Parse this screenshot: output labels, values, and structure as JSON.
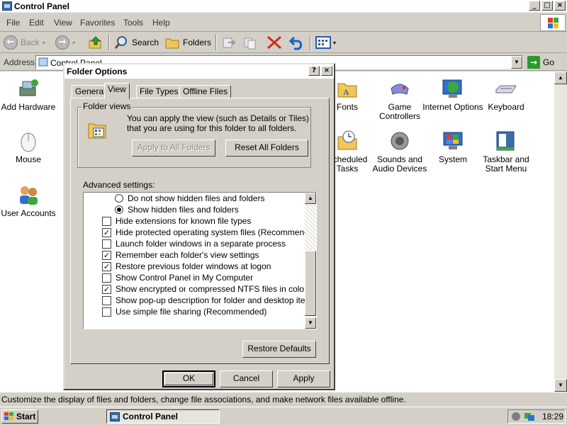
{
  "window": {
    "title": "Control Panel",
    "controls": [
      "_",
      "□",
      "×"
    ]
  },
  "menu": [
    "File",
    "Edit",
    "View",
    "Favorites",
    "Tools",
    "Help"
  ],
  "toolbar": {
    "back": "Back",
    "search": "Search",
    "folders": "Folders"
  },
  "address": {
    "label": "Address",
    "value": "Control Panel",
    "go": "Go"
  },
  "control_panel_items": [
    "Add Hardware",
    "Mouse",
    "User Accounts",
    "Fonts",
    "Game Controllers",
    "Internet Options",
    "Keyboard",
    "Scheduled Tasks",
    "Sounds and Audio Devices",
    "System",
    "Taskbar and Start Menu"
  ],
  "dialog": {
    "title": "Folder Options",
    "title_buttons": [
      "?",
      "×"
    ],
    "tabs": [
      "General",
      "View",
      "File Types",
      "Offline Files"
    ],
    "active_tab": "View",
    "folder_views": {
      "group_title": "Folder views",
      "description": "You can apply the view (such as Details or Tiles) that you are using for this folder to all folders.",
      "apply_all": "Apply to All Folders",
      "reset_all": "Reset All Folders"
    },
    "advanced_label": "Advanced settings:",
    "settings": [
      {
        "type": "radio",
        "label": "Do not show hidden files and folders",
        "checked": false
      },
      {
        "type": "radio",
        "label": "Show hidden files and folders",
        "checked": true
      },
      {
        "type": "checkbox",
        "label": "Hide extensions for known file types",
        "checked": false
      },
      {
        "type": "checkbox",
        "label": "Hide protected operating system files (Recommended)",
        "checked": true
      },
      {
        "type": "checkbox",
        "label": "Launch folder windows in a separate process",
        "checked": false
      },
      {
        "type": "checkbox",
        "label": "Remember each folder's view settings",
        "checked": true
      },
      {
        "type": "checkbox",
        "label": "Restore previous folder windows at logon",
        "checked": true
      },
      {
        "type": "checkbox",
        "label": "Show Control Panel in My Computer",
        "checked": false
      },
      {
        "type": "checkbox",
        "label": "Show encrypted or compressed NTFS files in color",
        "checked": true
      },
      {
        "type": "checkbox",
        "label": "Show pop-up description for folder and desktop items",
        "checked": false
      },
      {
        "type": "checkbox",
        "label": "Use simple file sharing (Recommended)",
        "checked": false
      }
    ],
    "restore_defaults": "Restore Defaults",
    "ok": "OK",
    "cancel": "Cancel",
    "apply": "Apply"
  },
  "status": "Customize the display of files and folders, change file associations, and make network files available offline.",
  "taskbar": {
    "start": "Start",
    "task": "Control Panel",
    "clock": "18:29"
  },
  "colors": {
    "desktop_gray": "#d4d0c8",
    "check_green": "#2a9a2a",
    "accent_blue": "#3a6ea5"
  },
  "icons": [
    "back-icon",
    "forward-icon",
    "up-icon",
    "search-icon",
    "folders-icon",
    "move-to-icon",
    "copy-to-icon",
    "delete-icon",
    "undo-icon",
    "views-icon"
  ]
}
